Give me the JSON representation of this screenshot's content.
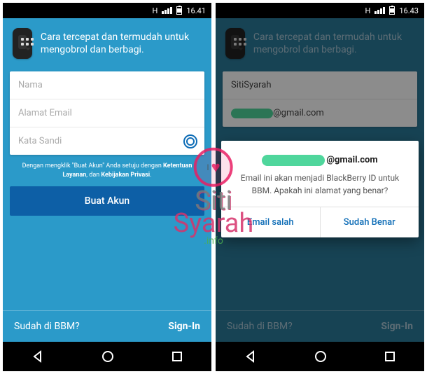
{
  "status": {
    "net": "H",
    "time_left": "16.41",
    "time_right": "16.43"
  },
  "header_text": "Cara tercepat dan termudah untuk mengobrol dan berbagi.",
  "form": {
    "name_placeholder": "Nama",
    "email_placeholder": "Alamat Email",
    "password_placeholder": "Kata Sandi"
  },
  "terms_prefix": "Dengan mengklik \"Buat Akun\" Anda setuju dengan ",
  "terms_link1": "Ketentuan Layanan",
  "terms_mid": ", dan ",
  "terms_link2": "Kebijakan Privasi",
  "btn_create": "Buat Akun",
  "footer_left": "Sudah di BBM?",
  "footer_right": "Sign-In",
  "right": {
    "name_value": "SitiSyarah",
    "email_suffix": "@gmail.com"
  },
  "dialog": {
    "email_suffix": "@gmail.com",
    "body": "Email ini akan menjadi BlackBerry ID untuk BBM. Apakah ini alamat yang benar?",
    "btn_wrong": "Email salah",
    "btn_correct": "Sudah Benar"
  },
  "watermark": {
    "i": "I",
    "line1": "Siti",
    "line2": "Syara",
    "h": "h",
    "info": ".info"
  }
}
